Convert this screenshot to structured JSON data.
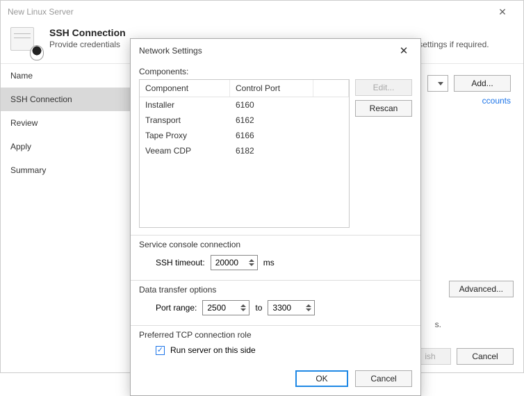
{
  "window": {
    "title": "New Linux Server"
  },
  "header": {
    "title": "SSH Connection",
    "subtitle_left": "Provide credentials",
    "subtitle_right": "dvanced settings if required."
  },
  "sidebar": {
    "items": [
      {
        "label": "Name"
      },
      {
        "label": "SSH Connection"
      },
      {
        "label": "Review"
      },
      {
        "label": "Apply"
      },
      {
        "label": "Summary"
      }
    ],
    "active_index": 1
  },
  "content": {
    "add_label": "Add...",
    "accounts_link": "ccounts",
    "credentials_period": "s.",
    "advanced_label": "Advanced..."
  },
  "wizard_footer": {
    "finish_partial": "ish",
    "cancel": "Cancel"
  },
  "modal": {
    "title": "Network Settings",
    "components_label": "Components:",
    "columns": {
      "component": "Component",
      "port": "Control Port"
    },
    "rows": [
      {
        "component": "Installer",
        "port": "6160"
      },
      {
        "component": "Transport",
        "port": "6162"
      },
      {
        "component": "Tape Proxy",
        "port": "6166"
      },
      {
        "component": "Veeam CDP",
        "port": "6182"
      }
    ],
    "edit_label": "Edit...",
    "rescan_label": "Rescan",
    "service_section": "Service console connection",
    "ssh_timeout_label": "SSH timeout:",
    "ssh_timeout_value": "20000",
    "ssh_timeout_unit": "ms",
    "data_section": "Data transfer options",
    "port_range_label": "Port range:",
    "port_from": "2500",
    "port_to_label": "to",
    "port_to": "3300",
    "tcp_section": "Preferred TCP connection role",
    "tcp_checkbox_label": "Run server on this side",
    "ok": "OK",
    "cancel": "Cancel"
  }
}
